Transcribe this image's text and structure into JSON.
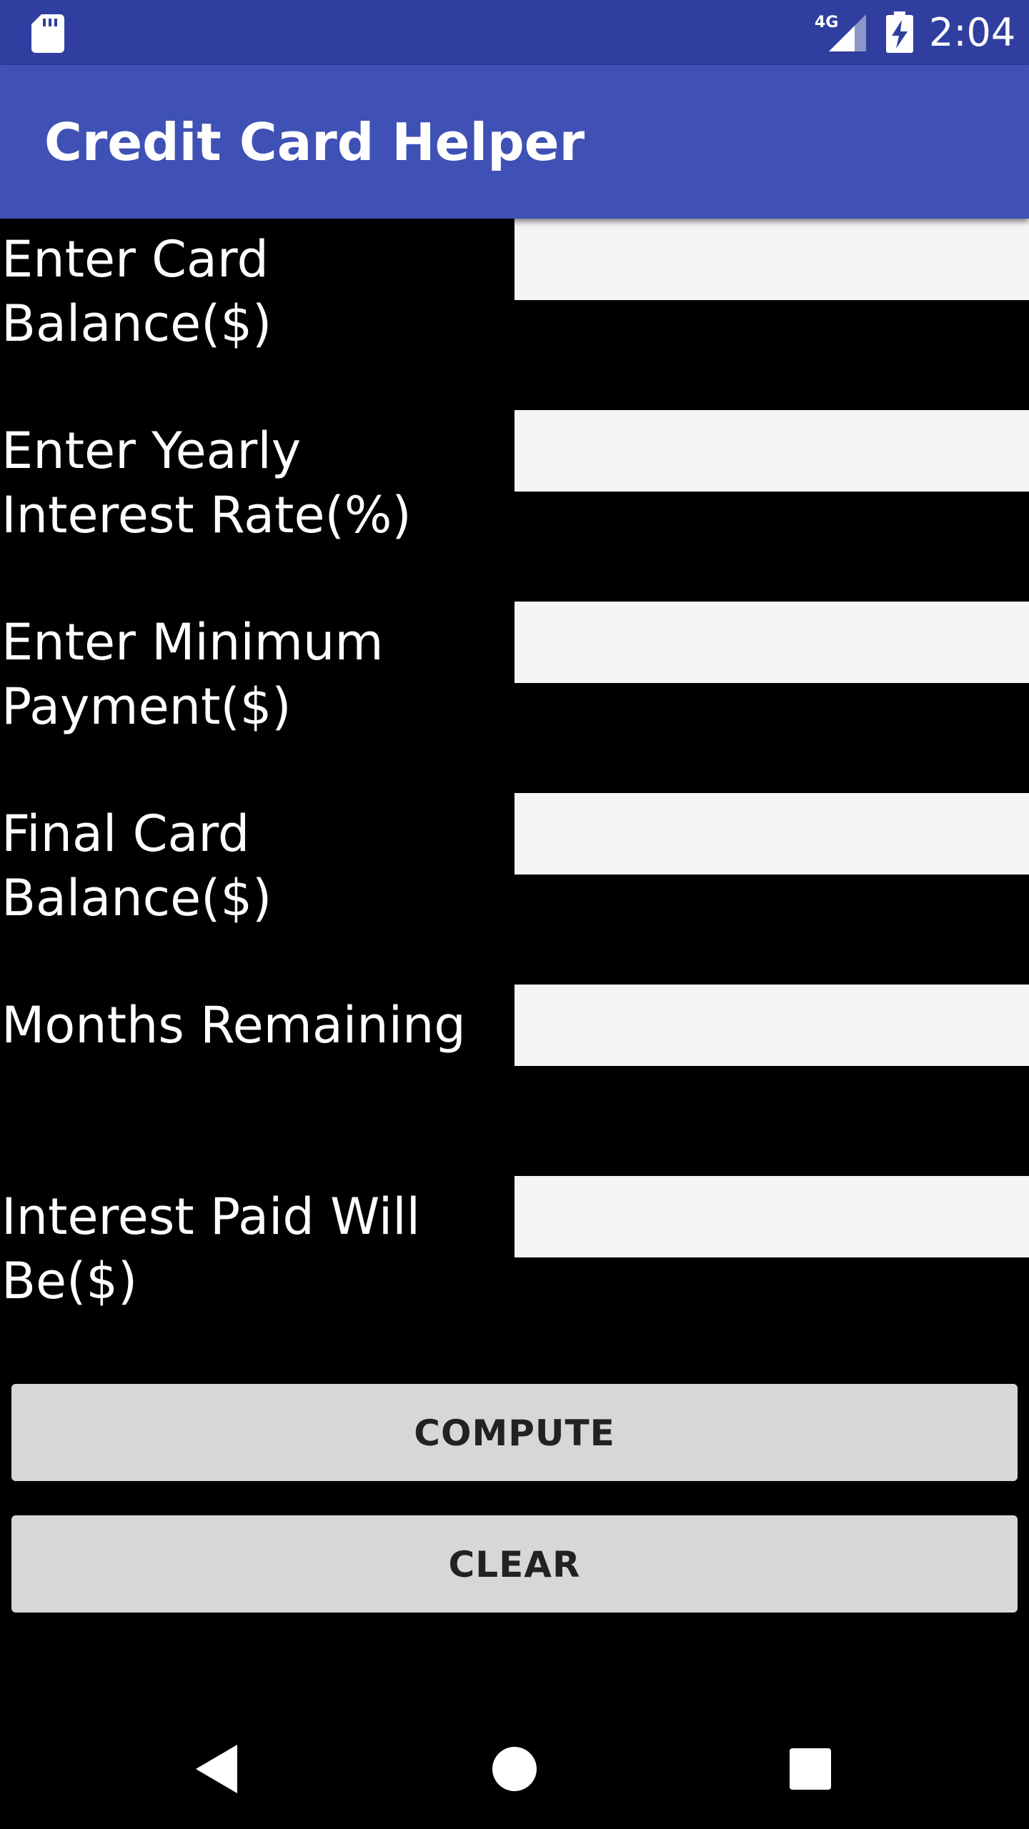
{
  "status_bar": {
    "time": "2:04",
    "network": "4G",
    "icons": [
      "sd-card-icon",
      "signal-icon",
      "battery-charging-icon"
    ]
  },
  "app_bar": {
    "title": "Credit Card Helper"
  },
  "form": {
    "rows": [
      {
        "label": "Enter Card Balance($)",
        "value": ""
      },
      {
        "label": "Enter Yearly Interest Rate(%)",
        "value": ""
      },
      {
        "label": "Enter Minimum Payment($)",
        "value": ""
      },
      {
        "label": "Final Card Balance($)",
        "value": ""
      },
      {
        "label": "Months Remaining",
        "value": ""
      },
      {
        "label": "Interest Paid Will Be($)",
        "value": ""
      }
    ]
  },
  "buttons": {
    "compute": "COMPUTE",
    "clear": "CLEAR"
  },
  "nav": {
    "icons": [
      "back-icon",
      "home-icon",
      "recents-icon"
    ]
  },
  "colors": {
    "status_bar": "#303F9F",
    "app_bar": "#3F51B5",
    "background": "#000000",
    "field": "#F7F4F4",
    "button": "#D6D7D6"
  }
}
